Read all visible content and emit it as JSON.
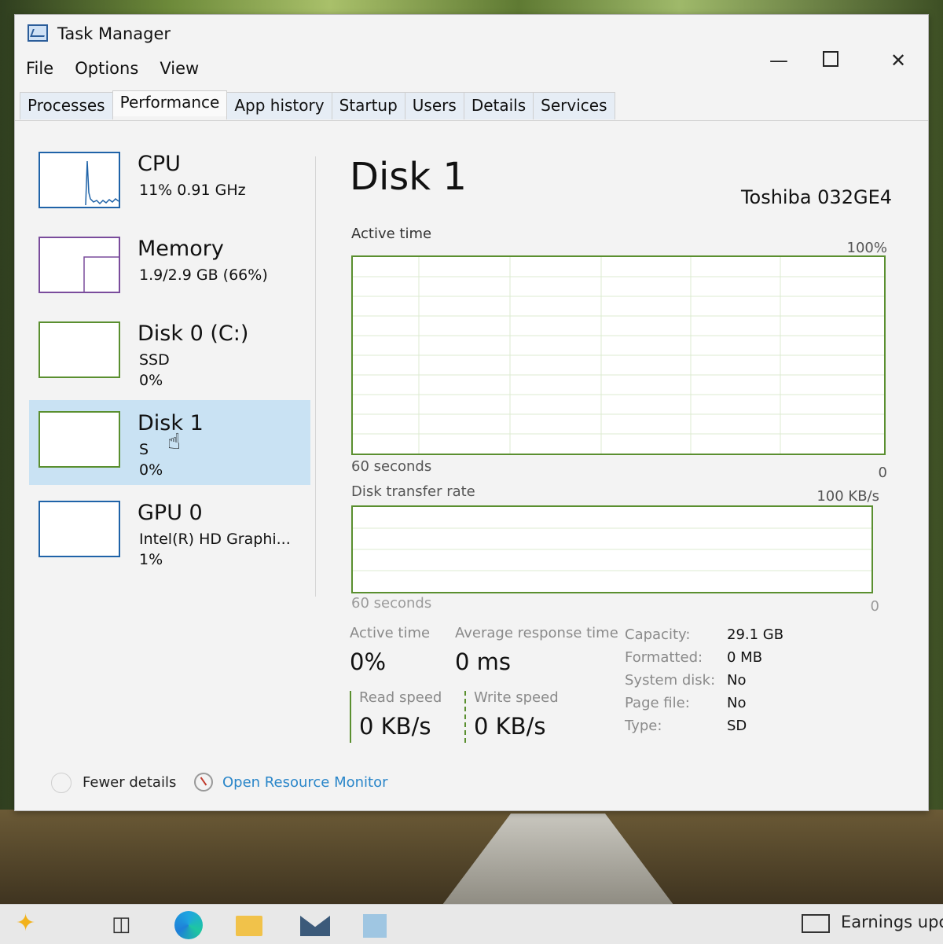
{
  "window": {
    "title": "Task Manager",
    "menu": [
      "File",
      "Options",
      "View"
    ],
    "tabs": [
      "Processes",
      "Performance",
      "App history",
      "Startup",
      "Users",
      "Details",
      "Services"
    ],
    "active_tab": "Performance"
  },
  "sidebar": {
    "items": [
      {
        "name": "CPU",
        "line1": "11%  0.91 GHz",
        "line2": ""
      },
      {
        "name": "Memory",
        "line1": "1.9/2.9 GB (66%)",
        "line2": ""
      },
      {
        "name": "Disk 0 (C:)",
        "line1": "SSD",
        "line2": "0%"
      },
      {
        "name": "Disk 1",
        "line1": "S",
        "line2": "0%"
      },
      {
        "name": "GPU 0",
        "line1": "Intel(R) HD Graphi...",
        "line2": "1%"
      }
    ],
    "selected": "Disk 1"
  },
  "detail": {
    "title": "Disk 1",
    "model": "Toshiba 032GE4",
    "active_time_graph": {
      "label": "Active time",
      "max": "100%",
      "time_span": "60 seconds",
      "min": "0"
    },
    "transfer_graph": {
      "label": "Disk transfer rate",
      "max": "100 KB/s",
      "time_span": "60 seconds",
      "min": "0"
    },
    "stats": {
      "active_time_label": "Active time",
      "active_time_value": "0%",
      "avg_response_label": "Average response time",
      "avg_response_value": "0 ms",
      "read_speed_label": "Read speed",
      "read_speed_value": "0 KB/s",
      "write_speed_label": "Write speed",
      "write_speed_value": "0 KB/s"
    },
    "properties": [
      {
        "label": "Capacity:",
        "value": "29.1 GB"
      },
      {
        "label": "Formatted:",
        "value": "0 MB"
      },
      {
        "label": "System disk:",
        "value": "No"
      },
      {
        "label": "Page file:",
        "value": "No"
      },
      {
        "label": "Type:",
        "value": "SD"
      }
    ]
  },
  "footer": {
    "fewer_details": "Fewer details",
    "open_monitor": "Open Resource Monitor"
  },
  "taskbar": {
    "news_text": "Earnings upco"
  },
  "colors": {
    "cpu": "#1f63a8",
    "memory": "#7a4c9c",
    "disk": "#5a8f2f",
    "selected": "#c9e2f3",
    "link": "#2a86c9"
  }
}
